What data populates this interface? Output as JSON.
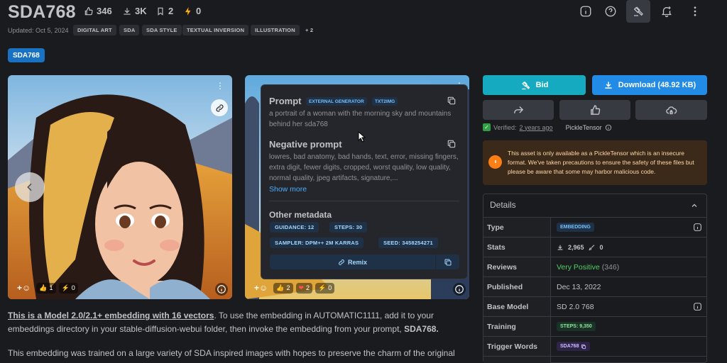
{
  "header": {
    "title": "SDA768",
    "likes": "346",
    "downloads": "3K",
    "bookmarks": "2",
    "buzz": "0",
    "updated": "Updated: Oct 5, 2024",
    "tags": [
      "DIGITAL ART",
      "SDA",
      "SDA STYLE",
      "TEXTUAL INVERSION",
      "ILLUSTRATION"
    ],
    "more_tags": "+ 2",
    "version_chip": "SDA768"
  },
  "gallery": {
    "image1_reactions": {
      "heart": "",
      "like": "1",
      "buzz": "0"
    },
    "image2_reactions": {
      "like": "2",
      "heart": "2",
      "buzz": "0"
    }
  },
  "popover": {
    "prompt_title": "Prompt",
    "badge_generator": "EXTERNAL GENERATOR",
    "badge_mode": "TXT2IMG",
    "prompt_text": "a portrait of a woman with the morning sky and mountains behind her sda768",
    "negative_title": "Negative prompt",
    "negative_text": "lowres, bad anatomy, bad hands, text, error, missing fingers, extra digit, fewer digits, cropped, worst quality, low quality, normal quality, jpeg artifacts, signature,...",
    "show_more": "Show more",
    "other_title": "Other metadata",
    "guidance": "GUIDANCE: 12",
    "steps": "STEPS: 30",
    "sampler": "SAMPLER: DPM++ 2M KARRAS",
    "seed": "SEED: 3458254271",
    "remix": "Remix"
  },
  "actions": {
    "bid": "Bid",
    "download": "Download (48.92 KB)",
    "verified_prefix": "Verified:",
    "verified_time": "2 years ago",
    "pickle": "PickleTensor"
  },
  "alert": {
    "text": "This asset is only available as a PickleTensor which is an insecure format. We've taken precautions to ensure the safety of these files but please be aware that some may harbor malicious code."
  },
  "details": {
    "title": "Details",
    "type_label": "Type",
    "type_value": "EMBEDDING",
    "stats_label": "Stats",
    "stats_downloads": "2,965",
    "stats_generations": "0",
    "reviews_label": "Reviews",
    "reviews_value": "Very Positive",
    "reviews_count": "(346)",
    "published_label": "Published",
    "published_value": "Dec 13, 2022",
    "base_label": "Base Model",
    "base_value": "SD 2.0 768",
    "training_label": "Training",
    "training_value": "STEPS: 9,350",
    "trigger_label": "Trigger Words",
    "trigger_value": "SDA768"
  },
  "description": {
    "p1_bold_link": "This is a Model 2.0/2.1+ embedding with 16 vectors",
    "p1_rest": ". To use the embedding in AUTOMATIC1111, add it to your embeddings directory in your stable-diffusion-webui folder, then invoke the embedding from your prompt, ",
    "p1_end_bold": "SDA768.",
    "p2": "This embedding was trained on a large variety of SDA inspired images with hopes to preserve the charm of the original"
  },
  "colors": {
    "background": "#1a1b1e",
    "bid": "#15aabf",
    "download": "#228be6",
    "alert": "#fd7e14",
    "positive": "#51cf66"
  }
}
